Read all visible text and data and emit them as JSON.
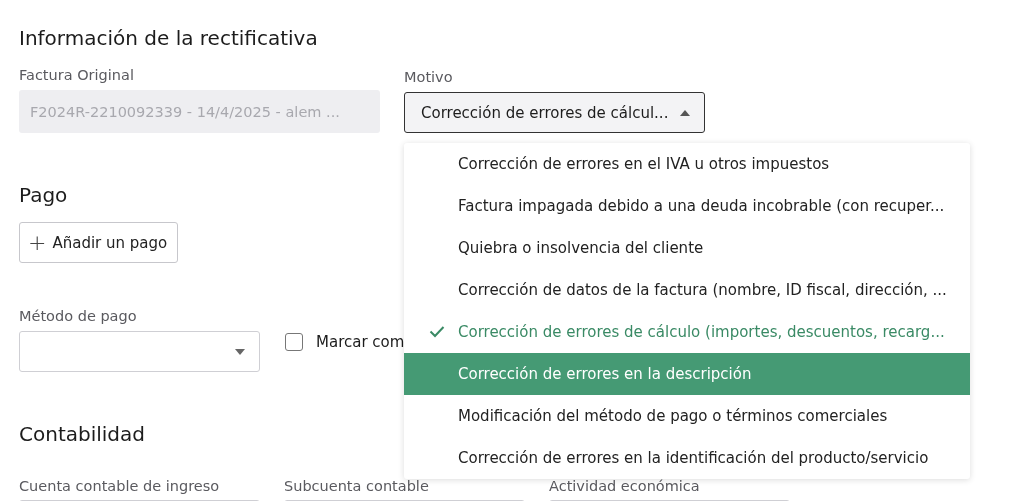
{
  "rectification": {
    "title": "Información de la rectificativa",
    "original_invoice": {
      "label": "Factura Original",
      "value": "F2024R-2210092339 - 14/4/2025 - alem ...",
      "disabled": true
    },
    "reason": {
      "label": "Motivo",
      "value": "Corrección de errores de cálcul...",
      "expanded": true
    }
  },
  "payment": {
    "title": "Pago",
    "add_button": {
      "icon": "+",
      "label": "Añadir un pago"
    },
    "method": {
      "label": "Método de pago"
    },
    "mark_paid": {
      "label": "Marcar com",
      "checked": false
    }
  },
  "accounting": {
    "title": "Contabilidad",
    "fields": [
      {
        "label": "Cuenta contable de ingreso"
      },
      {
        "label": "Subcuenta contable"
      },
      {
        "label": "Actividad económica"
      }
    ]
  },
  "reason_menu": {
    "items": [
      {
        "label": "Corrección de errores en el IVA u otros impuestos",
        "selected": false,
        "highlighted": false
      },
      {
        "label": "Factura impagada debido a una deuda incobrable (con recuper...",
        "selected": false,
        "highlighted": false
      },
      {
        "label": "Quiebra o insolvencia del cliente",
        "selected": false,
        "highlighted": false
      },
      {
        "label": "Corrección de datos de la factura (nombre, ID fiscal, dirección, ...",
        "selected": false,
        "highlighted": false
      },
      {
        "label": "Corrección de errores de cálculo (importes, descuentos, recarg...",
        "selected": true,
        "highlighted": false
      },
      {
        "label": "Corrección de errores en la descripción",
        "selected": false,
        "highlighted": true
      },
      {
        "label": "Modificación del método de pago o términos comerciales",
        "selected": false,
        "highlighted": false
      },
      {
        "label": "Corrección de errores en la identificación del producto/servicio",
        "selected": false,
        "highlighted": false
      }
    ]
  }
}
